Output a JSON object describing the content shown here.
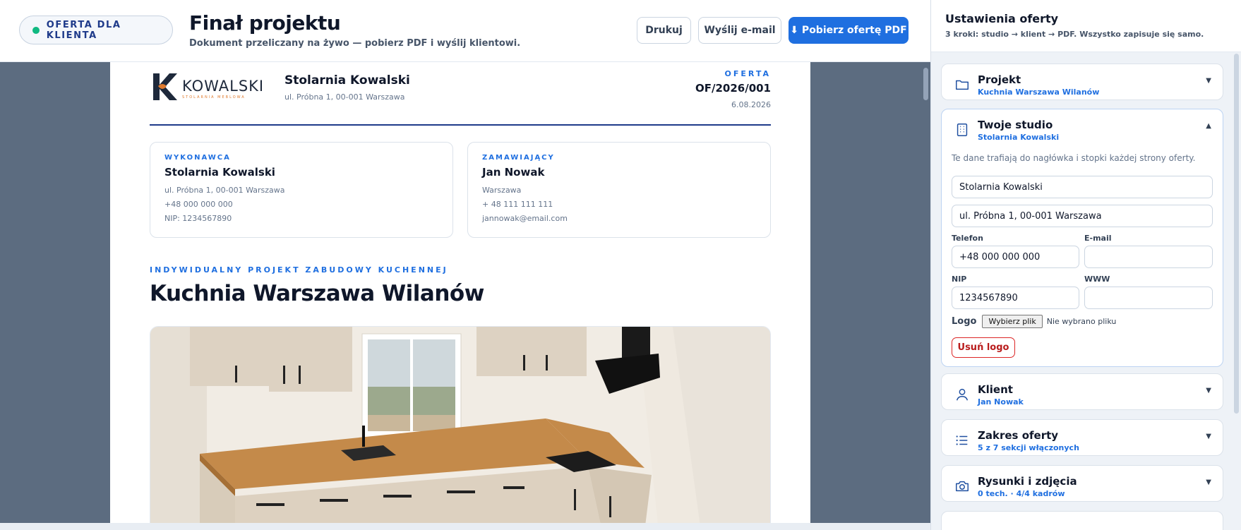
{
  "header": {
    "pill": "OFERTA DLA KLIENTA",
    "title": "Finał projektu",
    "subtitle": "Dokument przeliczany na żywo — pobierz PDF i wyślij klientowi.",
    "print_label": "Drukuj",
    "email_label": "Wyślij e-mail",
    "pdf_label": "⬇ Pobierz ofertę PDF"
  },
  "document": {
    "logo_text": "KOWALSKI",
    "logo_sub": "STOLARNIA MEBLOWA",
    "studio_name": "Stolarnia Kowalski",
    "studio_address": "ul. Próbna 1, 00-001 Warszawa",
    "offer_label": "OFERTA",
    "offer_number": "OF/2026/001",
    "offer_date": "6.08.2026",
    "contractor": {
      "label": "WYKONAWCA",
      "name": "Stolarnia Kowalski",
      "address": "ul. Próbna 1, 00-001 Warszawa",
      "phone": "+48 000 000 000",
      "nip": "NIP: 1234567890"
    },
    "client": {
      "label": "ZAMAWIAJĄCY",
      "name": "Jan Nowak",
      "city": "Warszawa",
      "phone": "+ 48 111 111 111",
      "email": "jannowak@email.com"
    },
    "project_kicker": "INDYWIDUALNY PROJEKT ZABUDOWY KUCHENNEJ",
    "project_title": "Kuchnia Warszawa Wilanów"
  },
  "panel": {
    "title": "Ustawienia oferty",
    "subtitle": "3 kroki: studio → klient → PDF. Wszystko zapisuje się samo.",
    "sections": [
      {
        "title": "Projekt",
        "sub": "Kuchnia Warszawa Wilanów",
        "icon": "folder-icon"
      },
      {
        "title": "Twoje studio",
        "sub": "Stolarnia Kowalski",
        "icon": "building-icon"
      },
      {
        "title": "Klient",
        "sub": "Jan Nowak",
        "icon": "user-icon"
      },
      {
        "title": "Zakres oferty",
        "sub": "5 z 7 sekcji włączonych",
        "icon": "list-icon"
      },
      {
        "title": "Rysunki i zdjęcia",
        "sub": "0 tech. · 4/4 kadrów",
        "icon": "camera-icon"
      }
    ],
    "studio_form": {
      "hint": "Te dane trafiają do nagłówka i stopki każdej strony oferty.",
      "name_value": "Stolarnia Kowalski",
      "address_value": "ul. Próbna 1, 00-001 Warszawa",
      "phone_label": "Telefon",
      "phone_value": "+48 000 000 000",
      "email_label": "E-mail",
      "email_value": "",
      "nip_label": "NIP",
      "nip_value": "1234567890",
      "www_label": "WWW",
      "www_value": "",
      "logo_label": "Logo",
      "file_button": "Wybierz plik",
      "file_status": "Nie wybrano pliku",
      "remove_logo": "Usuń logo"
    }
  },
  "colors": {
    "accent": "#1f6fe0",
    "navy": "#1e3a8a",
    "preview_bg": "#5c6c80",
    "status_dot": "#10b981",
    "danger": "#dc2626"
  }
}
